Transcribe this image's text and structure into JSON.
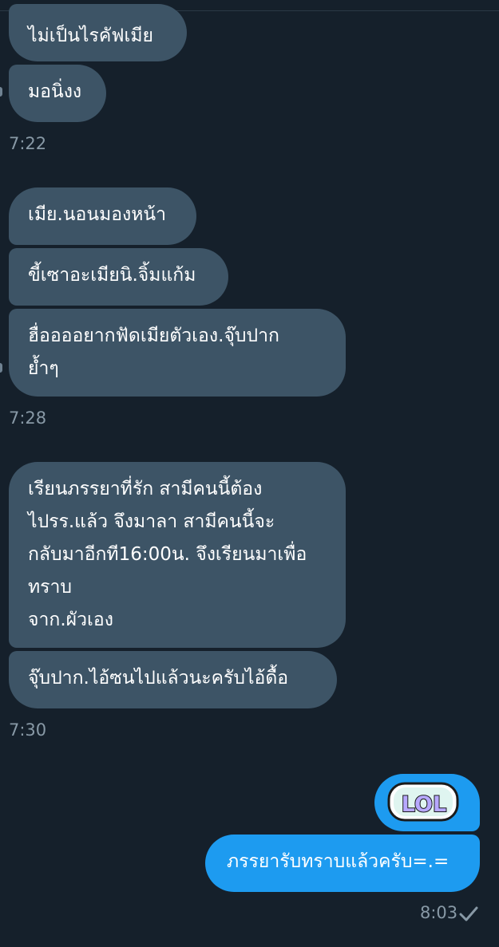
{
  "messages": {
    "m1": "ไม่เป็นไรคัฟเมีย",
    "m2": "มอนิ่งง",
    "m3": "เมีย.นอนมองหน้า",
    "m4": "ขี้เซาอะเมียนิ.จิ้มแก้ม",
    "m5": "ฮื่ออออยากฟัดเมียตัวเอง.จุ๊บปาก\nย้ำๆ",
    "m6": "เรียนภรรยาที่รัก  สามีคนนี้ต้อง\nไปรร.แล้ว จึงมาลา สามีคนนี้จะ\nกลับมาอีกที16:00น. จึงเรียนมาเพื่อ\nทราบ\nจาก.ผัวเอง",
    "m7": "จุ๊บปาก.ไอ้ซนไปแล้วนะครับไอ้ดื้อ",
    "out1": "ภรรยารับทราบแล้วครับ=.="
  },
  "timestamps": {
    "t1": "7:22",
    "t2": "7:28",
    "t3": "7:30",
    "t4": "8:03"
  },
  "sticker": {
    "text": "LOL",
    "icon": "lol-sticker-icon"
  },
  "status_icon": "check-icon",
  "colors": {
    "background": "#15202b",
    "incoming_bubble": "#3d5466",
    "outgoing_bubble": "#1d9bf0",
    "timestamp": "#8899a6",
    "sticker_text": "#b7a8ff"
  }
}
